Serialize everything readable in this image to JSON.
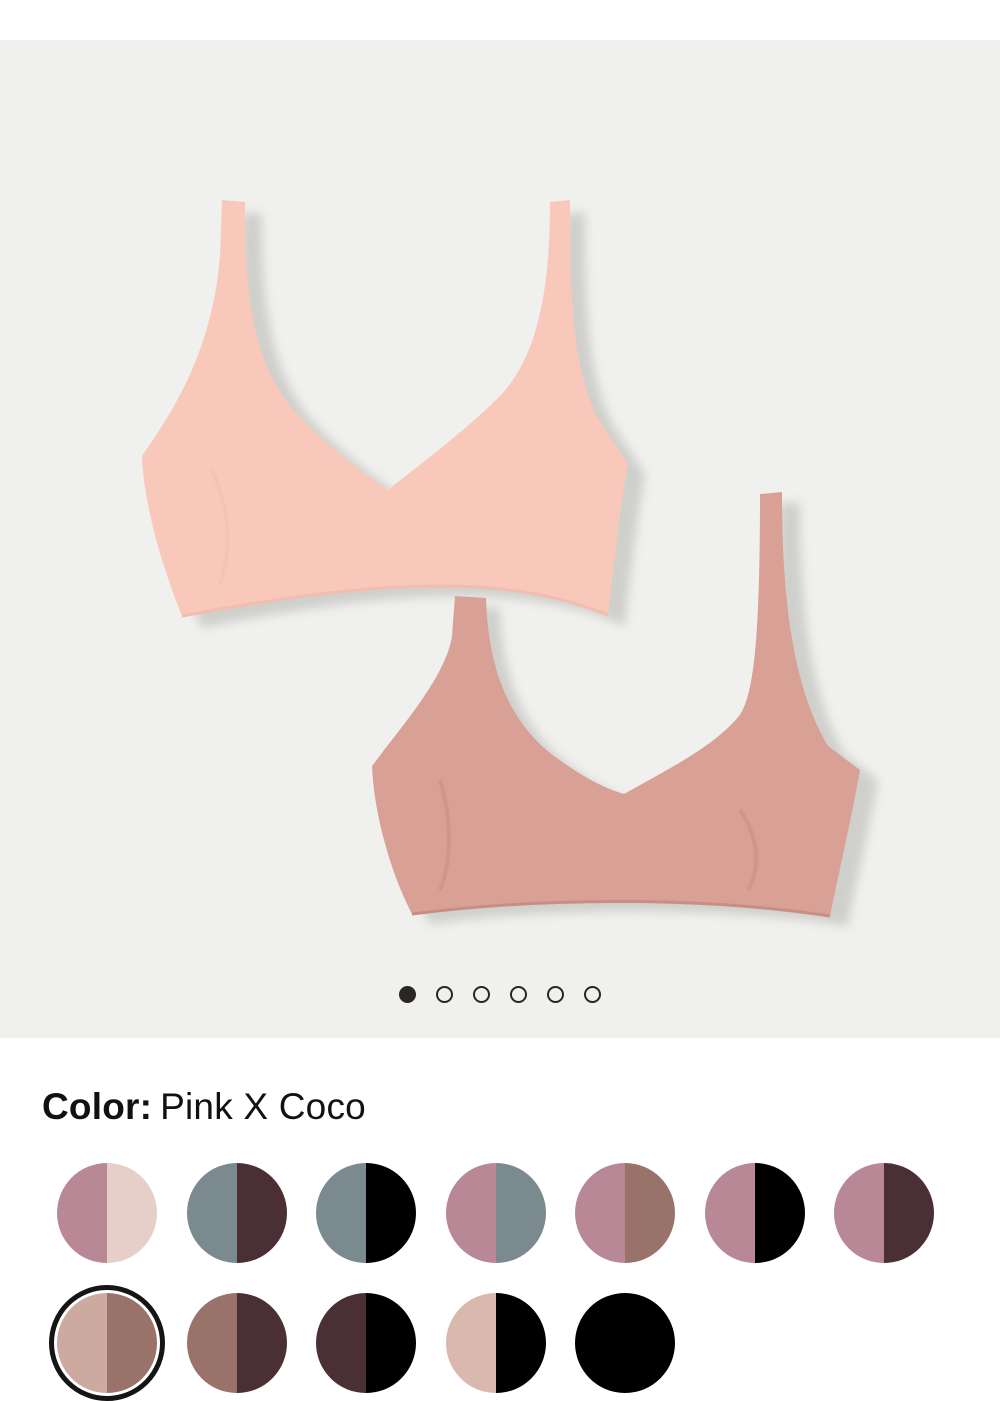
{
  "gallery": {
    "image_alt": "Two bralettes in Pink and Coco",
    "slide_count": 6,
    "active_slide": 1
  },
  "color": {
    "label": "Color:",
    "value": "Pink X Coco"
  },
  "swatches": [
    {
      "left": "#b88896",
      "right": "#e6cfc8"
    },
    {
      "left": "#7b8a8f",
      "right": "#4a2f35"
    },
    {
      "left": "#7b8a8f",
      "right": "#000000"
    },
    {
      "left": "#b88896",
      "right": "#7b8a8f"
    },
    {
      "left": "#b88896",
      "right": "#99726a"
    },
    {
      "left": "#b88896",
      "right": "#000000"
    },
    {
      "left": "#b88896",
      "right": "#4a2f35"
    },
    {
      "left": "#ccaaa0",
      "right": "#99726a",
      "selected": true
    },
    {
      "left": "#99726a",
      "right": "#4a2f35"
    },
    {
      "left": "#4a2f35",
      "right": "#000000"
    },
    {
      "left": "#d9b8ae",
      "right": "#000000"
    },
    {
      "left": "#000000",
      "right": "#000000"
    }
  ],
  "colors": {
    "background": "#ffffff",
    "gallery_bg": "#f0f0ee",
    "bra_pink": "#f8c9bb",
    "bra_coco": "#d9a195",
    "dot": "#2a2626"
  }
}
